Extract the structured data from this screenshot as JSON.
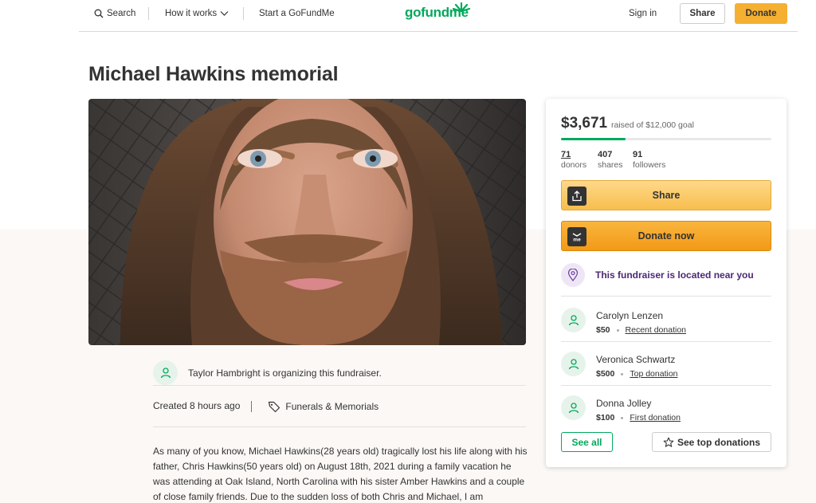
{
  "header": {
    "search_label": "Search",
    "how_it_works_label": "How it works",
    "start_label": "Start a GoFundMe",
    "logo_text": "gofundme",
    "signin_label": "Sign in",
    "share_label": "Share",
    "donate_label": "Donate"
  },
  "campaign": {
    "title": "Michael Hawkins memorial",
    "organizer_text": "Taylor Hambright is organizing this fundraiser.",
    "created": "Created 8 hours ago",
    "category": "Funerals & Memorials",
    "story": "As many of you know, Michael Hawkins(28 years old) tragically lost his life along with his father, Chris Hawkins(50 years old) on August 18th, 2021 during a family vacation he was attending at Oak Island, North Carolina with his sister Amber Hawkins and a couple of close family friends. Due to the sudden loss of both Chris and Michael, I am"
  },
  "sidebar": {
    "raised": "$3,671",
    "goal_text": "raised of $12,000 goal",
    "progress_fraction": 0.306,
    "stats": [
      {
        "value": "71",
        "label": "donors"
      },
      {
        "value": "407",
        "label": "shares"
      },
      {
        "value": "91",
        "label": "followers"
      }
    ],
    "share_button": "Share",
    "donate_button": "Donate now",
    "location_text": "This fundraiser is located near you",
    "donations": [
      {
        "name": "Carolyn Lenzen",
        "amount": "$50",
        "type": "Recent donation"
      },
      {
        "name": "Veronica Schwartz",
        "amount": "$500",
        "type": "Top donation"
      },
      {
        "name": "Donna Jolley",
        "amount": "$100",
        "type": "First donation"
      }
    ],
    "see_all_label": "See all",
    "see_top_label": "See top donations"
  },
  "colors": {
    "brand_green": "#02a95c",
    "donate_orange": "#f29a16",
    "location_purple": "#4b2873"
  },
  "icons": [
    "search-icon",
    "chevron-down-icon",
    "tag-icon",
    "user-icon",
    "upload-icon",
    "gofundme-icon",
    "location-pin-icon",
    "star-icon"
  ]
}
